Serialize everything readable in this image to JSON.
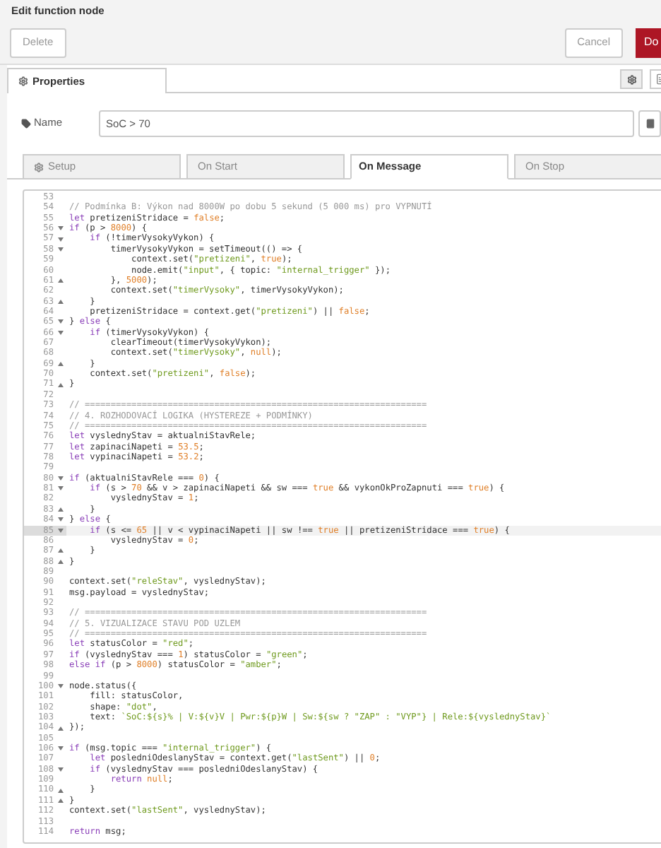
{
  "dialog": {
    "title": "Edit function node"
  },
  "toolbar": {
    "buttons": [
      {
        "label": "Delete",
        "kind": "plain"
      },
      {
        "label": "Cancel",
        "kind": "plain"
      },
      {
        "label": "Do",
        "kind": "primary"
      }
    ]
  },
  "properties_tab": {
    "label": "Properties",
    "selected": true
  },
  "name_field": {
    "label": "Name",
    "value": "SoC > 70"
  },
  "tabs": [
    {
      "label": "Setup",
      "selected": false,
      "icon": true
    },
    {
      "label": "On Start",
      "selected": false,
      "icon": false
    },
    {
      "label": "On Message",
      "selected": true,
      "icon": false
    },
    {
      "label": "On Stop",
      "selected": false,
      "icon": false
    }
  ],
  "editor": {
    "lines": [
      {
        "no": "53",
        "active": false,
        "kind": "plain"
      },
      {
        "no": "54",
        "active": false,
        "kind": "plain",
        "tokens": [
          {
            "kind": "comment",
            "text": "// Podmínka B: Výkon nad 8000W po dobu 5 sekund (5 000 ms) pro VYPNUTÍ"
          }
        ]
      },
      {
        "no": "55",
        "active": false,
        "kind": "plain",
        "tokens": [
          {
            "kind": "keyword",
            "text": "let"
          },
          {
            "kind": "plain",
            "text": " pretizeniStridace = "
          },
          {
            "kind": "number",
            "text": "false"
          },
          {
            "kind": "plain",
            "text": ";"
          }
        ]
      },
      {
        "no": "56",
        "active": false,
        "kind": "open",
        "tokens": [
          {
            "kind": "keyword",
            "text": "if"
          },
          {
            "kind": "plain",
            "text": " (p > "
          },
          {
            "kind": "number",
            "text": "8000"
          },
          {
            "kind": "plain",
            "text": ") {"
          }
        ]
      },
      {
        "no": "57",
        "active": false,
        "kind": "open",
        "tokens": [
          {
            "kind": "keyword",
            "text": "    if"
          },
          {
            "kind": "plain",
            "text": " (!timerVysokyVykon) {"
          }
        ]
      },
      {
        "no": "58",
        "active": false,
        "kind": "open",
        "tokens": [
          {
            "kind": "plain",
            "text": "        timerVysokyVykon = setTimeout(() => {"
          }
        ]
      },
      {
        "no": "59",
        "active": false,
        "kind": "plain",
        "tokens": [
          {
            "kind": "plain",
            "text": "            context.set("
          },
          {
            "kind": "string",
            "text": "\"pretizeni\""
          },
          {
            "kind": "plain",
            "text": ", "
          },
          {
            "kind": "number",
            "text": "true"
          },
          {
            "kind": "plain",
            "text": ");"
          }
        ]
      },
      {
        "no": "60",
        "active": false,
        "kind": "plain",
        "tokens": [
          {
            "kind": "plain",
            "text": "            node.emit("
          },
          {
            "kind": "string",
            "text": "\"input\""
          },
          {
            "kind": "plain",
            "text": ", { topic: "
          },
          {
            "kind": "string",
            "text": "\"internal_trigger\""
          },
          {
            "kind": "plain",
            "text": " });"
          }
        ]
      },
      {
        "no": "61",
        "active": false,
        "kind": "close",
        "tokens": [
          {
            "kind": "plain",
            "text": "        }, "
          },
          {
            "kind": "number",
            "text": "5000"
          },
          {
            "kind": "plain",
            "text": ");"
          }
        ]
      },
      {
        "no": "62",
        "active": false,
        "kind": "plain",
        "tokens": [
          {
            "kind": "plain",
            "text": "        context.set("
          },
          {
            "kind": "string",
            "text": "\"timerVysoky\""
          },
          {
            "kind": "plain",
            "text": ", timerVysokyVykon);"
          }
        ]
      },
      {
        "no": "63",
        "active": false,
        "kind": "close",
        "tokens": [
          {
            "kind": "plain",
            "text": "    }"
          }
        ]
      },
      {
        "no": "64",
        "active": false,
        "kind": "plain",
        "tokens": [
          {
            "kind": "plain",
            "text": "    pretizeniStridace = context.get("
          },
          {
            "kind": "string",
            "text": "\"pretizeni\""
          },
          {
            "kind": "plain",
            "text": ") || "
          },
          {
            "kind": "number",
            "text": "false"
          },
          {
            "kind": "plain",
            "text": ";"
          }
        ]
      },
      {
        "no": "65",
        "active": false,
        "kind": "open",
        "tokens": [
          {
            "kind": "plain",
            "text": "} "
          },
          {
            "kind": "keyword",
            "text": "else"
          },
          {
            "kind": "plain",
            "text": " {"
          }
        ]
      },
      {
        "no": "66",
        "active": false,
        "kind": "open",
        "tokens": [
          {
            "kind": "keyword",
            "text": "    if"
          },
          {
            "kind": "plain",
            "text": " (timerVysokyVykon) {"
          }
        ]
      },
      {
        "no": "67",
        "active": false,
        "kind": "plain",
        "tokens": [
          {
            "kind": "plain",
            "text": "        clearTimeout(timerVysokyVykon);"
          }
        ]
      },
      {
        "no": "68",
        "active": false,
        "kind": "plain",
        "tokens": [
          {
            "kind": "plain",
            "text": "        context.set("
          },
          {
            "kind": "string",
            "text": "\"timerVysoky\""
          },
          {
            "kind": "plain",
            "text": ", "
          },
          {
            "kind": "number",
            "text": "null"
          },
          {
            "kind": "plain",
            "text": ");"
          }
        ]
      },
      {
        "no": "69",
        "active": false,
        "kind": "close",
        "tokens": [
          {
            "kind": "plain",
            "text": "    }"
          }
        ]
      },
      {
        "no": "70",
        "active": false,
        "kind": "plain",
        "tokens": [
          {
            "kind": "plain",
            "text": "    context.set("
          },
          {
            "kind": "string",
            "text": "\"pretizeni\""
          },
          {
            "kind": "plain",
            "text": ", "
          },
          {
            "kind": "number",
            "text": "false"
          },
          {
            "kind": "plain",
            "text": ");"
          }
        ]
      },
      {
        "no": "71",
        "active": false,
        "kind": "close",
        "tokens": [
          {
            "kind": "plain",
            "text": "}"
          }
        ]
      },
      {
        "no": "72",
        "active": false,
        "kind": "plain"
      },
      {
        "no": "73",
        "active": false,
        "kind": "plain",
        "tokens": [
          {
            "kind": "comment",
            "text": "// =================================================================="
          }
        ]
      },
      {
        "no": "74",
        "active": false,
        "kind": "plain",
        "tokens": [
          {
            "kind": "comment",
            "text": "// 4. ROZHODOVACÍ LOGIKA (HYSTEREZE + PODMÍNKY)"
          }
        ]
      },
      {
        "no": "75",
        "active": false,
        "kind": "plain",
        "tokens": [
          {
            "kind": "comment",
            "text": "// =================================================================="
          }
        ]
      },
      {
        "no": "76",
        "active": false,
        "kind": "plain",
        "tokens": [
          {
            "kind": "keyword",
            "text": "let"
          },
          {
            "kind": "plain",
            "text": " vyslednyStav = aktualniStavRele;"
          }
        ]
      },
      {
        "no": "77",
        "active": false,
        "kind": "plain",
        "tokens": [
          {
            "kind": "keyword",
            "text": "let"
          },
          {
            "kind": "plain",
            "text": " zapinaciNapeti = "
          },
          {
            "kind": "number",
            "text": "53.5"
          },
          {
            "kind": "plain",
            "text": ";"
          }
        ]
      },
      {
        "no": "78",
        "active": false,
        "kind": "plain",
        "tokens": [
          {
            "kind": "keyword",
            "text": "let"
          },
          {
            "kind": "plain",
            "text": " vypinaciNapeti = "
          },
          {
            "kind": "number",
            "text": "53.2"
          },
          {
            "kind": "plain",
            "text": ";"
          }
        ]
      },
      {
        "no": "79",
        "active": false,
        "kind": "plain"
      },
      {
        "no": "80",
        "active": false,
        "kind": "open",
        "tokens": [
          {
            "kind": "keyword",
            "text": "if"
          },
          {
            "kind": "plain",
            "text": " (aktualniStavRele === "
          },
          {
            "kind": "number",
            "text": "0"
          },
          {
            "kind": "plain",
            "text": ") {"
          }
        ]
      },
      {
        "no": "81",
        "active": false,
        "kind": "open",
        "tokens": [
          {
            "kind": "keyword",
            "text": "    if"
          },
          {
            "kind": "plain",
            "text": " (s > "
          },
          {
            "kind": "number",
            "text": "70"
          },
          {
            "kind": "plain",
            "text": " && v > zapinaciNapeti && sw === "
          },
          {
            "kind": "number",
            "text": "true"
          },
          {
            "kind": "plain",
            "text": " && vykonOkProZapnuti === "
          },
          {
            "kind": "number",
            "text": "true"
          },
          {
            "kind": "plain",
            "text": ") {"
          }
        ]
      },
      {
        "no": "82",
        "active": false,
        "kind": "plain",
        "tokens": [
          {
            "kind": "plain",
            "text": "        vyslednyStav = "
          },
          {
            "kind": "number",
            "text": "1"
          },
          {
            "kind": "plain",
            "text": ";"
          }
        ]
      },
      {
        "no": "83",
        "active": false,
        "kind": "close",
        "tokens": [
          {
            "kind": "plain",
            "text": "    }"
          }
        ]
      },
      {
        "no": "84",
        "active": false,
        "kind": "open",
        "tokens": [
          {
            "kind": "plain",
            "text": "} "
          },
          {
            "kind": "keyword",
            "text": "else"
          },
          {
            "kind": "plain",
            "text": " {"
          }
        ]
      },
      {
        "no": "85",
        "active": true,
        "kind": "open",
        "tokens": [
          {
            "kind": "keyword",
            "text": "    if"
          },
          {
            "kind": "plain",
            "text": " (s <= "
          },
          {
            "kind": "number",
            "text": "65"
          },
          {
            "kind": "plain",
            "text": " || v < vypinaciNapeti || sw !== "
          },
          {
            "kind": "number",
            "text": "true"
          },
          {
            "kind": "plain",
            "text": " || pretizeniStridace === "
          },
          {
            "kind": "number",
            "text": "true"
          },
          {
            "kind": "plain",
            "text": ") {"
          }
        ]
      },
      {
        "no": "86",
        "active": false,
        "kind": "plain",
        "tokens": [
          {
            "kind": "plain",
            "text": "        vyslednyStav = "
          },
          {
            "kind": "number",
            "text": "0"
          },
          {
            "kind": "plain",
            "text": ";"
          }
        ]
      },
      {
        "no": "87",
        "active": false,
        "kind": "close",
        "tokens": [
          {
            "kind": "plain",
            "text": "    }"
          }
        ]
      },
      {
        "no": "88",
        "active": false,
        "kind": "close",
        "tokens": [
          {
            "kind": "plain",
            "text": "}"
          }
        ]
      },
      {
        "no": "89",
        "active": false,
        "kind": "plain"
      },
      {
        "no": "90",
        "active": false,
        "kind": "plain",
        "tokens": [
          {
            "kind": "plain",
            "text": "context.set("
          },
          {
            "kind": "string",
            "text": "\"releStav\""
          },
          {
            "kind": "plain",
            "text": ", vyslednyStav);"
          }
        ]
      },
      {
        "no": "91",
        "active": false,
        "kind": "plain",
        "tokens": [
          {
            "kind": "plain",
            "text": "msg.payload = vyslednyStav;"
          }
        ]
      },
      {
        "no": "92",
        "active": false,
        "kind": "plain"
      },
      {
        "no": "93",
        "active": false,
        "kind": "plain",
        "tokens": [
          {
            "kind": "comment",
            "text": "// =================================================================="
          }
        ]
      },
      {
        "no": "94",
        "active": false,
        "kind": "plain",
        "tokens": [
          {
            "kind": "comment",
            "text": "// 5. VIZUALIZACE STAVU POD UZLEM"
          }
        ]
      },
      {
        "no": "95",
        "active": false,
        "kind": "plain",
        "tokens": [
          {
            "kind": "comment",
            "text": "// =================================================================="
          }
        ]
      },
      {
        "no": "96",
        "active": false,
        "kind": "plain",
        "tokens": [
          {
            "kind": "keyword",
            "text": "let"
          },
          {
            "kind": "plain",
            "text": " statusColor = "
          },
          {
            "kind": "string",
            "text": "\"red\""
          },
          {
            "kind": "plain",
            "text": ";"
          }
        ]
      },
      {
        "no": "97",
        "active": false,
        "kind": "plain",
        "tokens": [
          {
            "kind": "keyword",
            "text": "if"
          },
          {
            "kind": "plain",
            "text": " (vyslednyStav === "
          },
          {
            "kind": "number",
            "text": "1"
          },
          {
            "kind": "plain",
            "text": ") statusColor = "
          },
          {
            "kind": "string",
            "text": "\"green\""
          },
          {
            "kind": "plain",
            "text": ";"
          }
        ]
      },
      {
        "no": "98",
        "active": false,
        "kind": "plain",
        "tokens": [
          {
            "kind": "keyword",
            "text": "else if"
          },
          {
            "kind": "plain",
            "text": " (p > "
          },
          {
            "kind": "number",
            "text": "8000"
          },
          {
            "kind": "plain",
            "text": ") statusColor = "
          },
          {
            "kind": "string",
            "text": "\"amber\""
          },
          {
            "kind": "plain",
            "text": ";"
          }
        ]
      },
      {
        "no": "99",
        "active": false,
        "kind": "plain"
      },
      {
        "no": "100",
        "active": false,
        "kind": "open",
        "tokens": [
          {
            "kind": "plain",
            "text": "node.status({"
          }
        ]
      },
      {
        "no": "101",
        "active": false,
        "kind": "plain",
        "tokens": [
          {
            "kind": "plain",
            "text": "    fill: statusColor,"
          }
        ]
      },
      {
        "no": "102",
        "active": false,
        "kind": "plain",
        "tokens": [
          {
            "kind": "plain",
            "text": "    shape: "
          },
          {
            "kind": "string",
            "text": "\"dot\""
          },
          {
            "kind": "plain",
            "text": ","
          }
        ]
      },
      {
        "no": "103",
        "active": false,
        "kind": "plain",
        "tokens": [
          {
            "kind": "plain",
            "text": "    text: "
          },
          {
            "kind": "string",
            "text": "`SoC:${s}% | V:${v}V | Pwr:${p}W | Sw:${sw ? \"ZAP\" : \"VYP\"} | Rele:${vyslednyStav}`"
          }
        ]
      },
      {
        "no": "104",
        "active": false,
        "kind": "close",
        "tokens": [
          {
            "kind": "plain",
            "text": "});"
          }
        ]
      },
      {
        "no": "105",
        "active": false,
        "kind": "plain"
      },
      {
        "no": "106",
        "active": false,
        "kind": "open",
        "tokens": [
          {
            "kind": "keyword",
            "text": "if"
          },
          {
            "kind": "plain",
            "text": " (msg.topic === "
          },
          {
            "kind": "string",
            "text": "\"internal_trigger\""
          },
          {
            "kind": "plain",
            "text": ") {"
          }
        ]
      },
      {
        "no": "107",
        "active": false,
        "kind": "plain",
        "tokens": [
          {
            "kind": "keyword",
            "text": "    let"
          },
          {
            "kind": "plain",
            "text": " posledniOdeslanyStav = context.get("
          },
          {
            "kind": "string",
            "text": "\"lastSent\""
          },
          {
            "kind": "plain",
            "text": ") || "
          },
          {
            "kind": "number",
            "text": "0"
          },
          {
            "kind": "plain",
            "text": ";"
          }
        ]
      },
      {
        "no": "108",
        "active": false,
        "kind": "open",
        "tokens": [
          {
            "kind": "keyword",
            "text": "    if"
          },
          {
            "kind": "plain",
            "text": " (vyslednyStav === posledniOdeslanyStav) {"
          }
        ]
      },
      {
        "no": "109",
        "active": false,
        "kind": "plain",
        "tokens": [
          {
            "kind": "keyword",
            "text": "        return "
          },
          {
            "kind": "number",
            "text": "null"
          },
          {
            "kind": "plain",
            "text": ";"
          }
        ]
      },
      {
        "no": "110",
        "active": false,
        "kind": "close",
        "tokens": [
          {
            "kind": "plain",
            "text": "    }"
          }
        ]
      },
      {
        "no": "111",
        "active": false,
        "kind": "close",
        "tokens": [
          {
            "kind": "plain",
            "text": "}"
          }
        ]
      },
      {
        "no": "112",
        "active": false,
        "kind": "plain",
        "tokens": [
          {
            "kind": "plain",
            "text": "context.set("
          },
          {
            "kind": "string",
            "text": "\"lastSent\""
          },
          {
            "kind": "plain",
            "text": ", vyslednyStav);"
          }
        ]
      },
      {
        "no": "113",
        "active": false,
        "kind": "plain"
      },
      {
        "no": "114",
        "active": false,
        "kind": "plain",
        "tokens": [
          {
            "kind": "keyword",
            "text": "return"
          },
          {
            "kind": "plain",
            "text": " msg;"
          }
        ]
      }
    ]
  }
}
